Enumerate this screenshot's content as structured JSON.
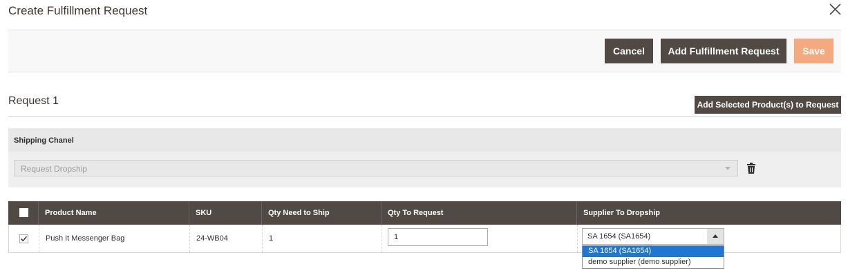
{
  "modal": {
    "title": "Create Fulfillment Request"
  },
  "toolbar": {
    "cancel_label": "Cancel",
    "add_fulfillment_label": "Add Fulfillment Request",
    "save_label": "Save"
  },
  "request": {
    "title": "Request 1",
    "add_selected_label": "Add Selected Product(s) to Request"
  },
  "shipping": {
    "label": "Shipping Chanel",
    "selected_value": "Request Dropship"
  },
  "table": {
    "headers": [
      "Product Name",
      "SKU",
      "Qty Need to Ship",
      "Qty To Request",
      "Supplier To Dropship"
    ],
    "rows": [
      {
        "checked": true,
        "product_name": "Push It Messenger Bag",
        "sku": "24-WB04",
        "qty_need": "1",
        "qty_request": "1",
        "supplier_selected": "SA 1654 (SA1654)"
      }
    ]
  },
  "supplier_dropdown": {
    "options": [
      "SA 1654 (SA1654)",
      "demo supplier (demo supplier)"
    ]
  },
  "colors": {
    "dark_button": "#514943",
    "save_button": "#f5a97e",
    "option_highlight": "#1e77d3"
  },
  "icons": [
    "close-icon",
    "trash-icon",
    "checkmark-icon",
    "dropdown-arrow-icon"
  ]
}
